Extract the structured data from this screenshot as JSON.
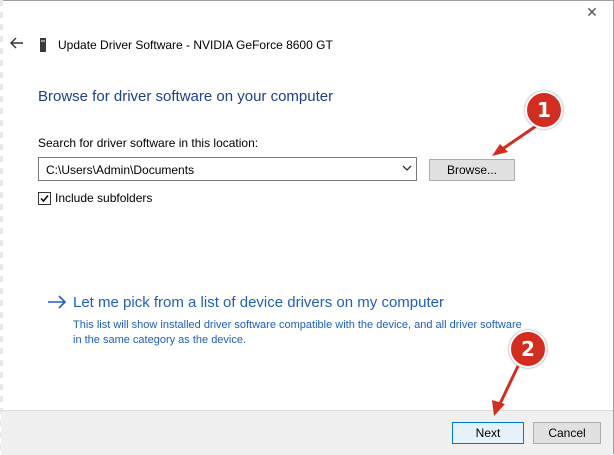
{
  "window": {
    "title": "Update Driver Software - NVIDIA GeForce 8600 GT",
    "close_glyph": "✕"
  },
  "main": {
    "heading": "Browse for driver software on your computer",
    "search_label": "Search for driver software in this location:",
    "path_value": "C:\\Users\\Admin\\Documents",
    "browse_label": "Browse...",
    "include_subfolders_label": "Include subfolders",
    "include_subfolders_checked": true,
    "pick_link": "Let me pick from a list of device drivers on my computer",
    "pick_description": "This list will show installed driver software compatible with the device, and all driver software in the same category as the device."
  },
  "footer": {
    "next_label": "Next",
    "cancel_label": "Cancel"
  },
  "annotations": [
    {
      "label": "1"
    },
    {
      "label": "2"
    }
  ],
  "colors": {
    "heading": "#1f3f8f",
    "link": "#1f5fbf",
    "annotation": "#d22d1f",
    "footer_bg": "#f0f0f0"
  },
  "icons": {
    "back": "back-arrow-icon",
    "device": "device-icon",
    "dropdown": "chevron-down-icon",
    "pick": "arrow-right-icon"
  }
}
